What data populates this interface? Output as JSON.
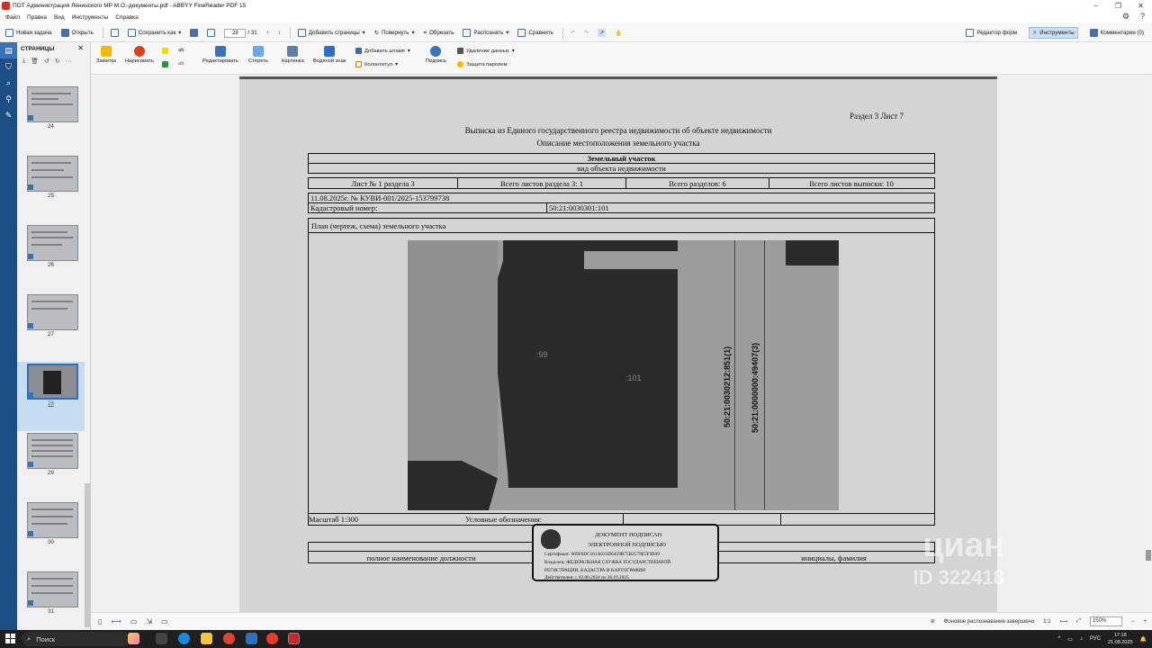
{
  "window": {
    "title": "ПОТ Администрация Ленинского МР М.О.-документы.pdf - ABBYY FineReader PDF 15",
    "controls": [
      "–",
      "❐",
      "✕"
    ]
  },
  "menu": [
    "Файл",
    "Правка",
    "Вид",
    "Инструменты",
    "Справка"
  ],
  "toolbar": {
    "new_task": "Новая задача",
    "open": "Открыть",
    "save_as": "Сохранить как",
    "page_current": "28",
    "page_total": "/ 31",
    "add_pages": "Добавить страницы",
    "rotate": "Повернуть",
    "crop": "Обрезать",
    "recognize": "Распознать",
    "compare": "Сравнить",
    "form_editor": "Редактор форм",
    "tools": "Инструменты",
    "comments": "Комментарии (0)"
  },
  "pages_panel": {
    "title": "СТРАНИЦЫ",
    "thumbnails": [
      "24",
      "25",
      "26",
      "27",
      "28",
      "29",
      "30",
      "31"
    ],
    "selected": "28"
  },
  "ribbon": {
    "note": "Заметка",
    "draw": "Нарисовать",
    "edit": "Редактировать",
    "erase": "Стереть",
    "picture": "Картинка",
    "watermark": "Водяной знак",
    "add_stamp": "Добавить штамп",
    "header_footer": "Колонтитул",
    "signature": "Подпись",
    "delete_data": "Удаление данных",
    "password": "Защита паролем",
    "ab": "ab"
  },
  "document": {
    "section_sheet": "Раздел 3    Лист 7",
    "title": "Выписка из Единого государственного реестра недвижимости об объекте недвижимости",
    "subtitle": "Описание местоположения земельного участка",
    "object_type": "Земельный участок",
    "object_type_label": "вид объекта недвижимости",
    "sheet_row": [
      "Лист № 1 раздела 3",
      "Всего листов раздела 3: 1",
      "Всего разделов: 6",
      "Всего листов выписки: 10"
    ],
    "doc_number": "11.08.2025г. № КУВИ-001/2025-153799738",
    "cadastral_label": "Кадастровый номер:",
    "cadastral_value": "50:21:0030301:101",
    "plan_title": "План (чертеж, схема) земельного участка",
    "plan_labels": {
      "p99": ":99",
      "p101": ":101",
      "v1": "50:21:0030212:851(1)",
      "v2": "50:21:0000000:49407(3)"
    },
    "scale": "Масштаб 1:300",
    "legend": "Условные обозначения:",
    "position_label": "полное наименование должности",
    "initials_label": "инициалы, фамилия"
  },
  "stamp": {
    "line1": "ДОКУМЕНТ ПОДПИСАН",
    "line2": "ЭЛЕКТРОННОЙ ПОДПИСЬЮ",
    "certificate": "Сертификат: 009F0DC161A023D6459B75B2579E5F9E09",
    "owner1": "Владелец: ФЕДЕРАЛЬНАЯ СЛУЖБА ГОСУДАРСТВЕННОЙ",
    "owner2": "РЕГИСТРАЦИИ, КАДАСТРА И КАРТОГРАФИИ",
    "valid": "Действителен: с 02.08.2024 по 26.10.2025"
  },
  "watermark": {
    "brand": "циан",
    "id": "ID 322418"
  },
  "statusbar": {
    "recognition": "Фоновое распознавание завершено",
    "ratio": "1:1",
    "zoom": "150%"
  },
  "taskbar": {
    "search": "Поиск",
    "lang": "РУС",
    "time": "17:18",
    "date": "21.08.2025"
  }
}
